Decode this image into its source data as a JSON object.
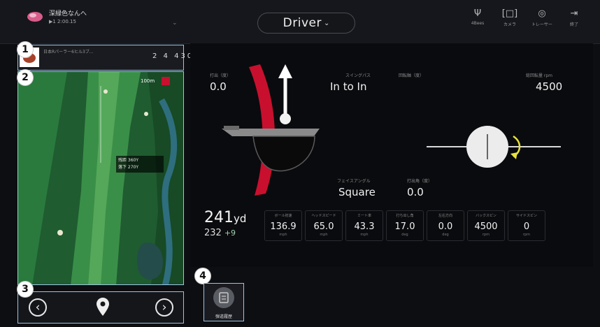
{
  "header": {
    "user_name": "深緑色なんへ",
    "user_sub": "▶1   2:00.15",
    "club": "Driver",
    "icons": [
      {
        "name": "signal-icon",
        "glyph": "Ψ",
        "label": "4Bees"
      },
      {
        "name": "camera-icon",
        "glyph": "[□]",
        "label": "カメラ"
      },
      {
        "name": "tracer-icon",
        "glyph": "◎",
        "label": "トレーサー"
      },
      {
        "name": "exit-icon",
        "glyph": "⇥",
        "label": "終了"
      }
    ]
  },
  "hole": {
    "name": "日本Rパーラー6ヒル3ブ...",
    "stats": "2  4  430"
  },
  "map": {
    "badge": "100m",
    "info_line1": "残距 360Y",
    "info_line2": "落下 270Y"
  },
  "swing": {
    "launch_label": "打出（度）",
    "launch_value": "0.0",
    "path_label": "スイングパス",
    "path_value": "In to In",
    "spin_axis_label": "回転軸（度）",
    "spin_label": "総回転量 rpm",
    "spin_value": "4500",
    "face_label": "フェイスアングル",
    "face_value": "Square",
    "angle_label": "打出角（度）",
    "angle_value": "0.0"
  },
  "distance": {
    "main": "241",
    "unit": "yd",
    "sub": "232",
    "diff": "+9"
  },
  "stats": [
    {
      "label": "ボール初速",
      "value": "136.9",
      "unit": "mph"
    },
    {
      "label": "ヘッドスピード",
      "value": "65.0",
      "unit": "mph"
    },
    {
      "label": "ミート率",
      "value": "43.3",
      "unit": "mph"
    },
    {
      "label": "打ち出し角",
      "value": "17.0",
      "unit": "deg"
    },
    {
      "label": "左右方向",
      "value": "0.0",
      "unit": "deg"
    },
    {
      "label": "バックスピン",
      "value": "4500",
      "unit": "rpm"
    },
    {
      "label": "サイドスピン",
      "value": "0",
      "unit": "rpm"
    }
  ],
  "history": {
    "label": "弾道履歴"
  },
  "callouts": [
    "1",
    "2",
    "3",
    "4"
  ],
  "colors": {
    "accent_red": "#c8102e",
    "highlight_border": "#9cc4e4",
    "arrow_yellow": "#e8e23a"
  }
}
